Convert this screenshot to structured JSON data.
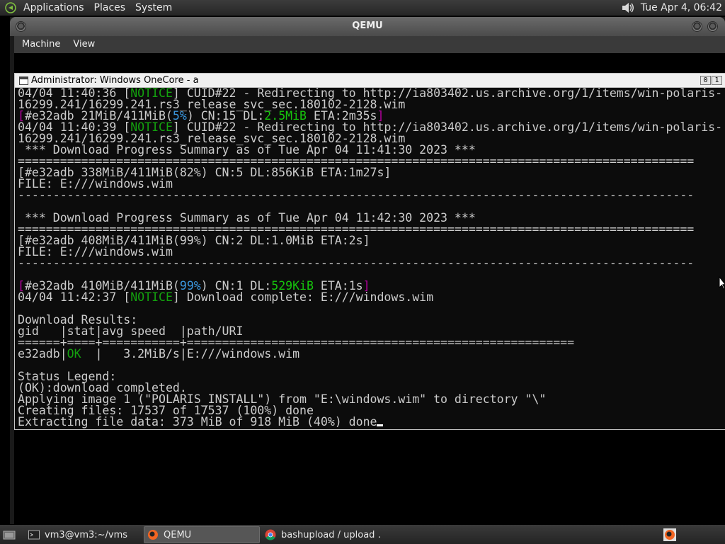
{
  "top_panel": {
    "menus": [
      "Applications",
      "Places",
      "System"
    ],
    "clock": "Tue Apr  4, 06:42",
    "icons": {
      "logo": "gnome-foot-icon",
      "volume": "volume-icon"
    }
  },
  "qemu": {
    "title": "QEMU",
    "menu": [
      "Machine",
      "View"
    ]
  },
  "console": {
    "title": "Administrator:  Windows OneCore - a",
    "controls": [
      "0",
      "1"
    ],
    "lines": [
      [
        {
          "t": "04/04 11:40:36 ["
        },
        {
          "t": "NOTICE",
          "c": "green"
        },
        {
          "t": "] CUID#22 - Redirecting to http://ia803402.us.archive.org/1/items/win-polaris-"
        }
      ],
      [
        {
          "t": "16299.241/16299.241.rs3_release_svc_sec.180102-2128.wim"
        }
      ],
      [
        {
          "t": "[",
          "c": "magenta"
        },
        {
          "t": "#e32adb 21MiB/411MiB("
        },
        {
          "t": "5%",
          "c": "cyan"
        },
        {
          "t": ") CN:15 DL:"
        },
        {
          "t": "2.5MiB",
          "c": "lime"
        },
        {
          "t": " ETA:2m35s"
        },
        {
          "t": "]",
          "c": "magenta"
        }
      ],
      [
        {
          "t": "04/04 11:40:39 ["
        },
        {
          "t": "NOTICE",
          "c": "green"
        },
        {
          "t": "] CUID#22 - Redirecting to http://ia803402.us.archive.org/1/items/win-polaris-"
        }
      ],
      [
        {
          "t": "16299.241/16299.241.rs3_release_svc_sec.180102-2128.wim"
        }
      ],
      [
        {
          "t": " *** Download Progress Summary as of Tue Apr 04 11:41:30 2023 ***"
        }
      ],
      [
        {
          "t": "================================================================================================"
        }
      ],
      [
        {
          "t": "[#e32adb 338MiB/411MiB(82%) CN:5 DL:856KiB ETA:1m27s]"
        }
      ],
      [
        {
          "t": "FILE: E:///windows.wim"
        }
      ],
      [
        {
          "t": "------------------------------------------------------------------------------------------------"
        }
      ],
      [
        {
          "t": ""
        }
      ],
      [
        {
          "t": " *** Download Progress Summary as of Tue Apr 04 11:42:30 2023 ***"
        }
      ],
      [
        {
          "t": "================================================================================================"
        }
      ],
      [
        {
          "t": "[#e32adb 408MiB/411MiB(99%) CN:2 DL:1.0MiB ETA:2s]"
        }
      ],
      [
        {
          "t": "FILE: E:///windows.wim"
        }
      ],
      [
        {
          "t": "------------------------------------------------------------------------------------------------"
        }
      ],
      [
        {
          "t": ""
        }
      ],
      [
        {
          "t": "[",
          "c": "magenta"
        },
        {
          "t": "#e32adb 410MiB/411MiB("
        },
        {
          "t": "99%",
          "c": "cyan"
        },
        {
          "t": ") CN:1 DL:"
        },
        {
          "t": "529KiB",
          "c": "lime"
        },
        {
          "t": " ETA:1s"
        },
        {
          "t": "]",
          "c": "magenta"
        }
      ],
      [
        {
          "t": "04/04 11:42:37 ["
        },
        {
          "t": "NOTICE",
          "c": "green"
        },
        {
          "t": "] Download complete: E:///windows.wim"
        }
      ],
      [
        {
          "t": ""
        }
      ],
      [
        {
          "t": "Download Results:"
        }
      ],
      [
        {
          "t": "gid   |stat|avg speed  |path/URI"
        }
      ],
      [
        {
          "t": "======+====+===========+======================================================="
        }
      ],
      [
        {
          "t": "e32adb|"
        },
        {
          "t": "OK",
          "c": "green"
        },
        {
          "t": "  |   3.2MiB/s|E:///windows.wim"
        }
      ],
      [
        {
          "t": ""
        }
      ],
      [
        {
          "t": "Status Legend:"
        }
      ],
      [
        {
          "t": "(OK):download completed."
        }
      ],
      [
        {
          "t": "Applying image 1 (\"POLARIS_INSTALL\") from \"E:\\windows.wim\" to directory \"\\\""
        }
      ],
      [
        {
          "t": "Creating files: 17537 of 17537 (100%) done"
        }
      ],
      [
        {
          "t": "Extracting file data: 373 MiB of 918 MiB (40%) done"
        }
      ]
    ]
  },
  "taskbar": {
    "tasks": [
      {
        "label": "vm3@vm3:~/vms",
        "icon": "terminal-icon"
      },
      {
        "label": "QEMU",
        "icon": "qemu-icon"
      },
      {
        "label": "bashupload / upload …",
        "icon": "chrome-icon"
      }
    ],
    "icons": {
      "show_desktop": "show-desktop-icon",
      "tray": "qemu-tray-icon"
    }
  },
  "colors": {
    "terminal_bg": "#0c0c0c",
    "terminal_fg": "#cccccc",
    "notice_green": "#13a10e",
    "percent_cyan": "#3a96dd",
    "bracket_magenta": "#b4009e",
    "speed_lime": "#16c60c"
  }
}
